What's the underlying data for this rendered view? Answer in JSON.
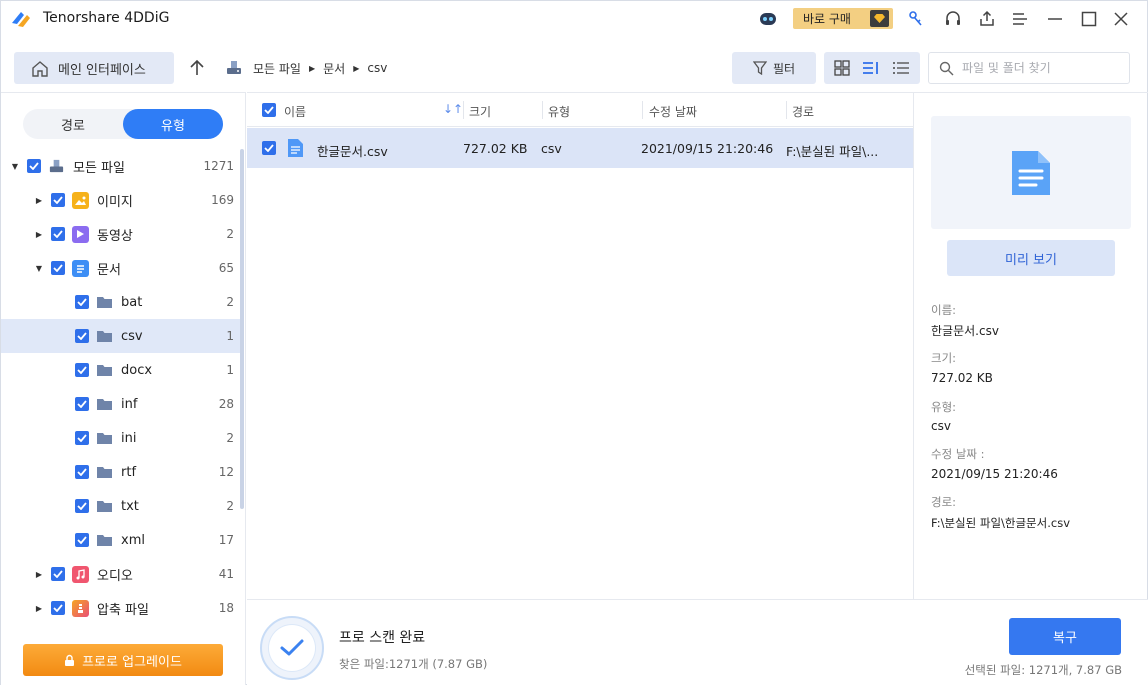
{
  "app": {
    "title": "Tenorshare 4DDiG",
    "buy_label": "바로 구매"
  },
  "toolbar": {
    "home_label": "메인 인터페이스",
    "breadcrumb": [
      "모든 파일",
      "문서",
      "csv"
    ],
    "filter_label": "필터",
    "search_placeholder": "파일 및 폴더 찾기"
  },
  "sidebar": {
    "tabs": [
      "경로",
      "유형"
    ],
    "active_tab": "유형",
    "tree": [
      {
        "label": "모든 파일",
        "count": "1271"
      },
      {
        "label": "이미지",
        "count": "169"
      },
      {
        "label": "동영상",
        "count": "2"
      },
      {
        "label": "문서",
        "count": "65"
      },
      {
        "label": "bat",
        "count": "2"
      },
      {
        "label": "csv",
        "count": "1"
      },
      {
        "label": "docx",
        "count": "1"
      },
      {
        "label": "inf",
        "count": "28"
      },
      {
        "label": "ini",
        "count": "2"
      },
      {
        "label": "rtf",
        "count": "12"
      },
      {
        "label": "txt",
        "count": "2"
      },
      {
        "label": "xml",
        "count": "17"
      },
      {
        "label": "오디오",
        "count": "41"
      },
      {
        "label": "압축 파일",
        "count": "18"
      }
    ],
    "upgrade_label": "프로로 업그레이드"
  },
  "list": {
    "columns": [
      "이름",
      "크기",
      "유형",
      "수정 날짜",
      "경로"
    ],
    "rows": [
      {
        "name": "한글문서.csv",
        "size": "727.02 KB",
        "type": "csv",
        "modified": "2021/09/15 21:20:46",
        "path": "F:\\분실된 파일\\..."
      }
    ]
  },
  "preview": {
    "button_label": "미리 보기",
    "name_label": "이름:",
    "name": "한글문서.csv",
    "size_label": "크기:",
    "size": "727.02 KB",
    "type_label": "유형:",
    "type": "csv",
    "modified_label": "수정 날짜 :",
    "modified": "2021/09/15 21:20:46",
    "path_label": "경로:",
    "path": "F:\\분실된 파일\\한글문서.csv"
  },
  "footer": {
    "status_title": "프로 스캔 완료",
    "status_sub": "찾은 파일:1271개 (7.87 GB)",
    "recover_label": "복구",
    "selected_info": "선택된 파일: 1271개, 7.87 GB"
  },
  "colors": {
    "accent": "#2f6fea",
    "selected_row": "#dbe4f7",
    "upgrade": "#f28a12"
  }
}
